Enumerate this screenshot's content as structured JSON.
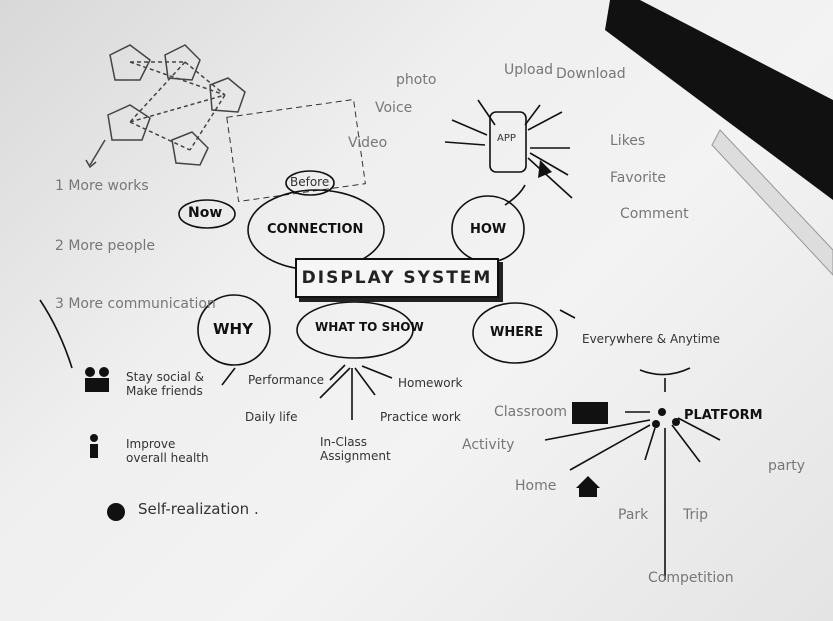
{
  "center": {
    "title": "DISPLAY SYSTEM"
  },
  "nodes": {
    "connection": "CONNECTION",
    "how": "HOW",
    "why": "WHY",
    "what": "WHAT TO SHOW",
    "where": "WHERE",
    "now": "Now",
    "before": "Before"
  },
  "connection_list": [
    "1 More works",
    "2 More people",
    "3 More communication"
  ],
  "app": {
    "screen_label": "APP",
    "features": [
      "photo",
      "Voice",
      "Video",
      "Upload",
      "Download",
      "Likes",
      "Favorite",
      "Comment"
    ]
  },
  "why": [
    "Stay social & Make friends",
    "Improve overall health",
    "Self-realization ."
  ],
  "what": [
    "Performance",
    "Homework",
    "Daily life",
    "Practice work",
    "In-Class Assignment"
  ],
  "where": {
    "top": "Everywhere & Anytime",
    "platform": "PLATFORM",
    "places": [
      "Classroom",
      "Activity",
      "Home",
      "Park",
      "Trip",
      "party",
      "Competition"
    ]
  },
  "colors": {
    "ink": "#111111",
    "pencil": "#777777",
    "paper": "#efefef"
  }
}
